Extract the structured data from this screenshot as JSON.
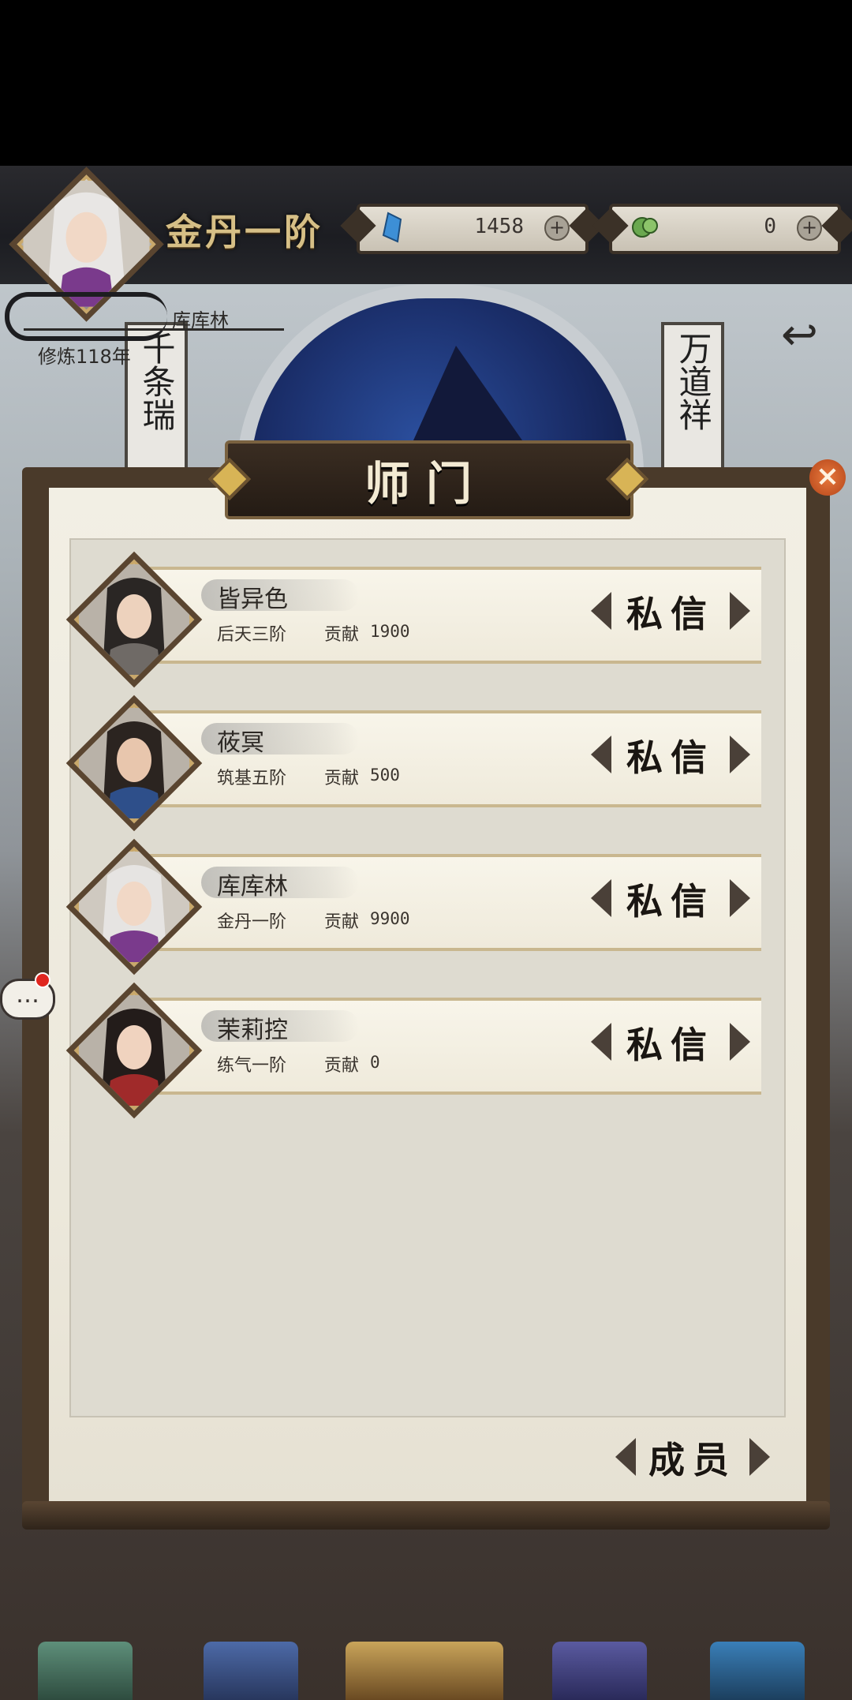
{
  "player": {
    "realm": "金丹一阶",
    "name": "库库林",
    "cultivation_years": "修炼118年"
  },
  "resources": {
    "crystal": {
      "icon": "blue-crystal-icon",
      "value": "1458",
      "plus": "+"
    },
    "jade": {
      "icon": "green-jade-icon",
      "value": "0",
      "plus": "+"
    }
  },
  "couplets": {
    "left": "千条瑞",
    "right": "万道祥"
  },
  "dialog": {
    "title": "师门",
    "close": "×",
    "members_button": "成员"
  },
  "members": [
    {
      "name": "皆异色",
      "rank": "后天三阶",
      "contrib_label": "贡献",
      "contrib_value": "1900",
      "action": "私信"
    },
    {
      "name": "莜冥",
      "rank": "筑基五阶",
      "contrib_label": "贡献",
      "contrib_value": "500",
      "action": "私信"
    },
    {
      "name": "库库林",
      "rank": "金丹一阶",
      "contrib_label": "贡献",
      "contrib_value": "9900",
      "action": "私信"
    },
    {
      "name": "茉莉控",
      "rank": "练气一阶",
      "contrib_label": "贡献",
      "contrib_value": "0",
      "action": "私信"
    }
  ],
  "chat": {
    "label": "…"
  },
  "colors": {
    "frame": "#4a3a2a",
    "paper": "#f2efe4",
    "gold": "#d6bf86",
    "notify_red": "#e0261f"
  }
}
